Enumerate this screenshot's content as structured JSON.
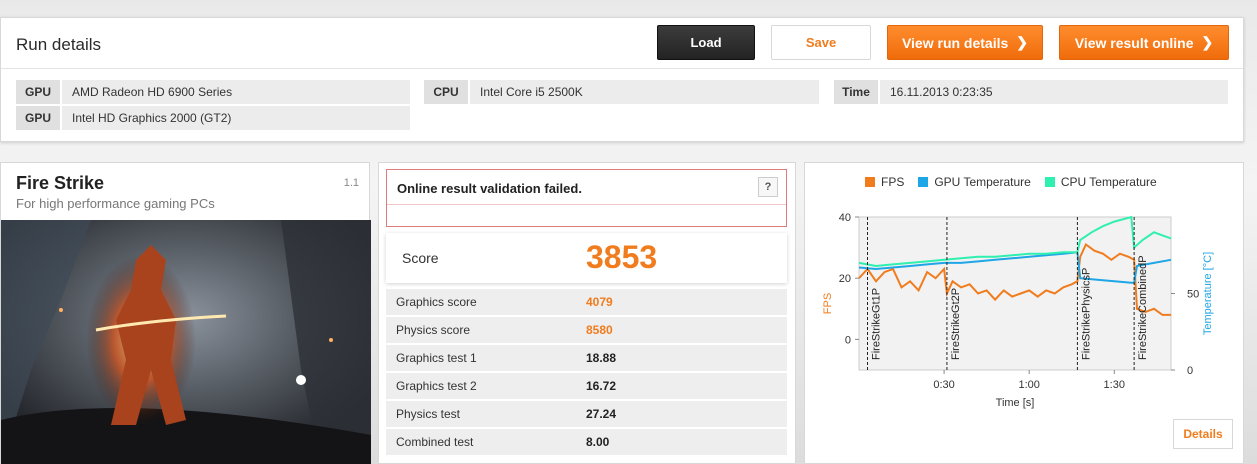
{
  "header": {
    "title": "Run details",
    "load_label": "Load",
    "save_label": "Save",
    "view_run_label": "View run details",
    "view_online_label": "View result online",
    "arrow_icon": "chevron-right-icon"
  },
  "system": {
    "gpu_label": "GPU",
    "gpu1": "AMD Radeon HD 6900 Series",
    "gpu2": "Intel HD Graphics 2000 (GT2)",
    "cpu_label": "CPU",
    "cpu": "Intel Core i5 2500K",
    "time_label": "Time",
    "time": "16.11.2013 0:23:35"
  },
  "benchmark": {
    "name": "Fire Strike",
    "subtitle": "For high performance gaming PCs",
    "version": "1.1"
  },
  "validation": {
    "message": "Online result validation failed.",
    "help": "?"
  },
  "score": {
    "label": "Score",
    "value": "3853",
    "rows": [
      {
        "label": "Graphics score",
        "value": "4079",
        "highlight": true
      },
      {
        "label": "Physics score",
        "value": "8580",
        "highlight": true
      },
      {
        "label": "Graphics test 1",
        "value": "18.88",
        "highlight": false
      },
      {
        "label": "Graphics test 2",
        "value": "16.72",
        "highlight": false
      },
      {
        "label": "Physics test",
        "value": "27.24",
        "highlight": false
      },
      {
        "label": "Combined test",
        "value": "8.00",
        "highlight": false
      }
    ]
  },
  "colors": {
    "accent": "#f07c1e",
    "fps": "#f07c1e",
    "gpu_temp": "#1fa6e6",
    "cpu_temp": "#2ff0b0"
  },
  "details_label": "Details",
  "chart_data": {
    "type": "line",
    "xlabel": "Time [s]",
    "ylabel": "FPS",
    "y2label": "Temperature [°C]",
    "x_ticks": [
      "0:30",
      "1:00",
      "1:30"
    ],
    "y_ticks": [
      0,
      20,
      40
    ],
    "y2_ticks": [
      0,
      50
    ],
    "ylim": [
      -10,
      40
    ],
    "y2lim": [
      0,
      100
    ],
    "xlim": [
      0,
      110
    ],
    "legend": [
      "FPS",
      "GPU Temperature",
      "CPU Temperature"
    ],
    "markers": [
      {
        "x": 3,
        "label": "FireStrikeGt1P"
      },
      {
        "x": 31,
        "label": "FireStrikeGt2P"
      },
      {
        "x": 77,
        "label": "FireStrikePhysicsP"
      },
      {
        "x": 97,
        "label": "FireStrikeCombinedP"
      }
    ],
    "series": [
      {
        "name": "FPS",
        "points": [
          [
            0,
            20
          ],
          [
            3,
            23
          ],
          [
            6,
            19
          ],
          [
            9,
            22
          ],
          [
            12,
            23
          ],
          [
            15,
            17
          ],
          [
            18,
            19
          ],
          [
            21,
            16
          ],
          [
            24,
            22
          ],
          [
            27,
            20
          ],
          [
            30,
            23
          ],
          [
            31,
            15
          ],
          [
            33,
            19
          ],
          [
            36,
            17
          ],
          [
            39,
            18
          ],
          [
            42,
            15
          ],
          [
            45,
            16
          ],
          [
            48,
            13
          ],
          [
            51,
            16
          ],
          [
            54,
            14
          ],
          [
            57,
            15
          ],
          [
            60,
            16
          ],
          [
            63,
            14
          ],
          [
            66,
            16
          ],
          [
            69,
            15
          ],
          [
            72,
            17
          ],
          [
            75,
            18
          ],
          [
            77,
            19
          ],
          [
            78,
            27
          ],
          [
            80,
            31
          ],
          [
            83,
            29
          ],
          [
            86,
            28
          ],
          [
            89,
            26
          ],
          [
            92,
            28
          ],
          [
            95,
            27
          ],
          [
            97,
            26
          ],
          [
            98,
            10
          ],
          [
            101,
            9
          ],
          [
            104,
            10
          ],
          [
            107,
            8
          ],
          [
            110,
            8
          ]
        ]
      },
      {
        "name": "GPU Temperature",
        "points": [
          [
            0,
            67
          ],
          [
            6,
            66
          ],
          [
            12,
            67
          ],
          [
            18,
            68
          ],
          [
            24,
            69
          ],
          [
            30,
            70
          ],
          [
            36,
            70
          ],
          [
            42,
            71
          ],
          [
            48,
            72
          ],
          [
            54,
            73
          ],
          [
            60,
            74
          ],
          [
            66,
            75
          ],
          [
            72,
            76
          ],
          [
            77,
            77
          ],
          [
            78,
            60
          ],
          [
            84,
            59
          ],
          [
            90,
            58
          ],
          [
            96,
            57
          ],
          [
            97,
            57
          ],
          [
            98,
            68
          ],
          [
            104,
            70
          ],
          [
            110,
            72
          ]
        ]
      },
      {
        "name": "CPU Temperature",
        "points": [
          [
            0,
            70
          ],
          [
            6,
            68
          ],
          [
            12,
            69
          ],
          [
            18,
            70
          ],
          [
            24,
            71
          ],
          [
            30,
            72
          ],
          [
            36,
            73
          ],
          [
            42,
            74
          ],
          [
            48,
            74
          ],
          [
            54,
            75
          ],
          [
            60,
            76
          ],
          [
            66,
            76
          ],
          [
            72,
            77
          ],
          [
            77,
            77
          ],
          [
            78,
            85
          ],
          [
            82,
            90
          ],
          [
            86,
            94
          ],
          [
            90,
            97
          ],
          [
            96,
            100
          ],
          [
            97,
            80
          ],
          [
            100,
            85
          ],
          [
            104,
            90
          ],
          [
            107,
            88
          ],
          [
            110,
            86
          ]
        ]
      }
    ]
  }
}
